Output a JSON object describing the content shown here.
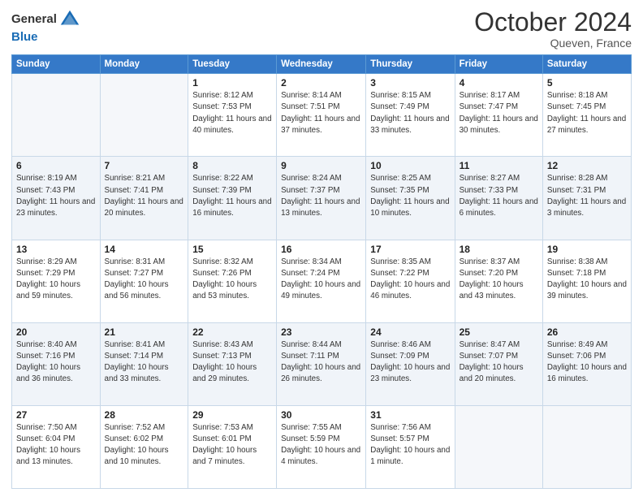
{
  "header": {
    "logo_line1": "General",
    "logo_line2": "Blue",
    "month": "October 2024",
    "location": "Queven, France"
  },
  "weekdays": [
    "Sunday",
    "Monday",
    "Tuesday",
    "Wednesday",
    "Thursday",
    "Friday",
    "Saturday"
  ],
  "weeks": [
    [
      {
        "day": "",
        "info": ""
      },
      {
        "day": "",
        "info": ""
      },
      {
        "day": "1",
        "info": "Sunrise: 8:12 AM\nSunset: 7:53 PM\nDaylight: 11 hours and 40 minutes."
      },
      {
        "day": "2",
        "info": "Sunrise: 8:14 AM\nSunset: 7:51 PM\nDaylight: 11 hours and 37 minutes."
      },
      {
        "day": "3",
        "info": "Sunrise: 8:15 AM\nSunset: 7:49 PM\nDaylight: 11 hours and 33 minutes."
      },
      {
        "day": "4",
        "info": "Sunrise: 8:17 AM\nSunset: 7:47 PM\nDaylight: 11 hours and 30 minutes."
      },
      {
        "day": "5",
        "info": "Sunrise: 8:18 AM\nSunset: 7:45 PM\nDaylight: 11 hours and 27 minutes."
      }
    ],
    [
      {
        "day": "6",
        "info": "Sunrise: 8:19 AM\nSunset: 7:43 PM\nDaylight: 11 hours and 23 minutes."
      },
      {
        "day": "7",
        "info": "Sunrise: 8:21 AM\nSunset: 7:41 PM\nDaylight: 11 hours and 20 minutes."
      },
      {
        "day": "8",
        "info": "Sunrise: 8:22 AM\nSunset: 7:39 PM\nDaylight: 11 hours and 16 minutes."
      },
      {
        "day": "9",
        "info": "Sunrise: 8:24 AM\nSunset: 7:37 PM\nDaylight: 11 hours and 13 minutes."
      },
      {
        "day": "10",
        "info": "Sunrise: 8:25 AM\nSunset: 7:35 PM\nDaylight: 11 hours and 10 minutes."
      },
      {
        "day": "11",
        "info": "Sunrise: 8:27 AM\nSunset: 7:33 PM\nDaylight: 11 hours and 6 minutes."
      },
      {
        "day": "12",
        "info": "Sunrise: 8:28 AM\nSunset: 7:31 PM\nDaylight: 11 hours and 3 minutes."
      }
    ],
    [
      {
        "day": "13",
        "info": "Sunrise: 8:29 AM\nSunset: 7:29 PM\nDaylight: 10 hours and 59 minutes."
      },
      {
        "day": "14",
        "info": "Sunrise: 8:31 AM\nSunset: 7:27 PM\nDaylight: 10 hours and 56 minutes."
      },
      {
        "day": "15",
        "info": "Sunrise: 8:32 AM\nSunset: 7:26 PM\nDaylight: 10 hours and 53 minutes."
      },
      {
        "day": "16",
        "info": "Sunrise: 8:34 AM\nSunset: 7:24 PM\nDaylight: 10 hours and 49 minutes."
      },
      {
        "day": "17",
        "info": "Sunrise: 8:35 AM\nSunset: 7:22 PM\nDaylight: 10 hours and 46 minutes."
      },
      {
        "day": "18",
        "info": "Sunrise: 8:37 AM\nSunset: 7:20 PM\nDaylight: 10 hours and 43 minutes."
      },
      {
        "day": "19",
        "info": "Sunrise: 8:38 AM\nSunset: 7:18 PM\nDaylight: 10 hours and 39 minutes."
      }
    ],
    [
      {
        "day": "20",
        "info": "Sunrise: 8:40 AM\nSunset: 7:16 PM\nDaylight: 10 hours and 36 minutes."
      },
      {
        "day": "21",
        "info": "Sunrise: 8:41 AM\nSunset: 7:14 PM\nDaylight: 10 hours and 33 minutes."
      },
      {
        "day": "22",
        "info": "Sunrise: 8:43 AM\nSunset: 7:13 PM\nDaylight: 10 hours and 29 minutes."
      },
      {
        "day": "23",
        "info": "Sunrise: 8:44 AM\nSunset: 7:11 PM\nDaylight: 10 hours and 26 minutes."
      },
      {
        "day": "24",
        "info": "Sunrise: 8:46 AM\nSunset: 7:09 PM\nDaylight: 10 hours and 23 minutes."
      },
      {
        "day": "25",
        "info": "Sunrise: 8:47 AM\nSunset: 7:07 PM\nDaylight: 10 hours and 20 minutes."
      },
      {
        "day": "26",
        "info": "Sunrise: 8:49 AM\nSunset: 7:06 PM\nDaylight: 10 hours and 16 minutes."
      }
    ],
    [
      {
        "day": "27",
        "info": "Sunrise: 7:50 AM\nSunset: 6:04 PM\nDaylight: 10 hours and 13 minutes."
      },
      {
        "day": "28",
        "info": "Sunrise: 7:52 AM\nSunset: 6:02 PM\nDaylight: 10 hours and 10 minutes."
      },
      {
        "day": "29",
        "info": "Sunrise: 7:53 AM\nSunset: 6:01 PM\nDaylight: 10 hours and 7 minutes."
      },
      {
        "day": "30",
        "info": "Sunrise: 7:55 AM\nSunset: 5:59 PM\nDaylight: 10 hours and 4 minutes."
      },
      {
        "day": "31",
        "info": "Sunrise: 7:56 AM\nSunset: 5:57 PM\nDaylight: 10 hours and 1 minute."
      },
      {
        "day": "",
        "info": ""
      },
      {
        "day": "",
        "info": ""
      }
    ]
  ]
}
